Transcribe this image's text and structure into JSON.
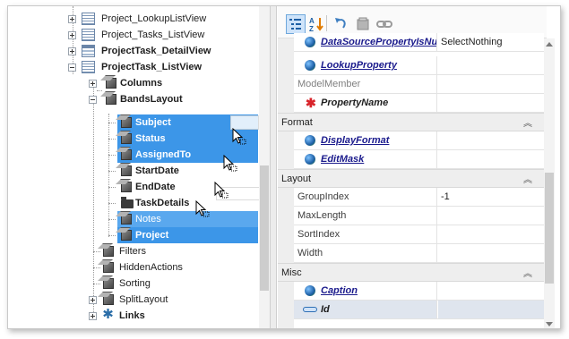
{
  "tree": {
    "nodes": [
      {
        "label": "Project_LookupListView",
        "bold": false
      },
      {
        "label": "Project_Tasks_ListView",
        "bold": false
      },
      {
        "label": "ProjectTask_DetailView",
        "bold": true
      },
      {
        "label": "ProjectTask_ListView",
        "bold": true
      },
      {
        "label": "Columns",
        "bold": true
      },
      {
        "label": "BandsLayout",
        "bold": true
      },
      {
        "label": "Subject",
        "bold": true
      },
      {
        "label": "Status",
        "bold": true
      },
      {
        "label": "AssignedTo",
        "bold": true
      },
      {
        "label": "StartDate",
        "bold": true
      },
      {
        "label": "EndDate",
        "bold": true
      },
      {
        "label": "TaskDetails",
        "bold": true
      },
      {
        "label": "Notes",
        "bold": false
      },
      {
        "label": "Project",
        "bold": true
      },
      {
        "label": "Filters",
        "bold": false
      },
      {
        "label": "HiddenActions",
        "bold": false
      },
      {
        "label": "Sorting",
        "bold": false
      },
      {
        "label": "SplitLayout",
        "bold": false
      },
      {
        "label": "Links",
        "bold": true
      }
    ]
  },
  "property_grid": {
    "toolbar": {
      "categorized_icon": "categorized-icon",
      "alphabetical_icon": "sort-az-icon",
      "undo_icon": "undo-icon",
      "reset_icon": "reset-icon",
      "link_icon": "link-icon"
    },
    "rows": [
      {
        "name": "DataSourcePropertyIsNu",
        "value": "SelectNothing"
      },
      {
        "name": "LookupProperty",
        "value": ""
      },
      {
        "name": "ModelMember",
        "value": ""
      },
      {
        "name": "PropertyName",
        "value": ""
      }
    ],
    "categories": [
      {
        "label": "Format",
        "collapse": "⌃⌃"
      },
      {
        "label": "Layout",
        "collapse": "⌃⌃"
      },
      {
        "label": "Misc",
        "collapse": "⌃⌃"
      }
    ],
    "format_rows": [
      {
        "name": "DisplayFormat",
        "value": ""
      },
      {
        "name": "EditMask",
        "value": ""
      }
    ],
    "layout_rows": [
      {
        "name": "GroupIndex",
        "value": "-1"
      },
      {
        "name": "MaxLength",
        "value": ""
      },
      {
        "name": "SortIndex",
        "value": ""
      },
      {
        "name": "Width",
        "value": ""
      }
    ],
    "misc_rows": [
      {
        "name": "Caption",
        "value": ""
      },
      {
        "name": "Id",
        "value": ""
      }
    ]
  },
  "colors": {
    "selection": "#3c96e8",
    "link": "#1a1a8c",
    "category_bg": "#eeeeee",
    "indicator": "#9ccc3c"
  }
}
